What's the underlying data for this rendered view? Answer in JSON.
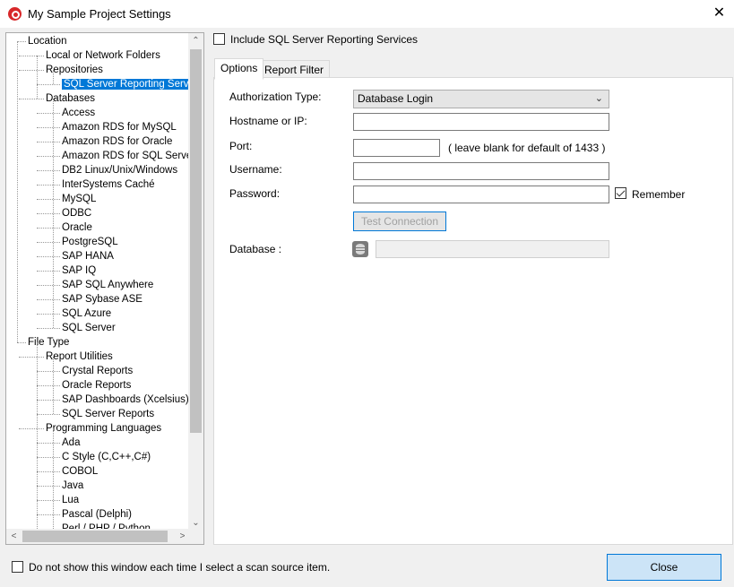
{
  "window": {
    "title": "My Sample Project Settings",
    "close_glyph": "✕"
  },
  "tree": {
    "nodes": [
      {
        "label": "Location",
        "level": 0
      },
      {
        "label": "Local or Network Folders",
        "level": 1
      },
      {
        "label": "Repositories",
        "level": 1
      },
      {
        "label": "SQL Server Reporting Service",
        "level": 2,
        "selected": true
      },
      {
        "label": "Databases",
        "level": 1
      },
      {
        "label": "Access",
        "level": 2
      },
      {
        "label": "Amazon RDS for MySQL",
        "level": 2
      },
      {
        "label": "Amazon RDS for Oracle",
        "level": 2
      },
      {
        "label": "Amazon RDS for SQL Server",
        "level": 2
      },
      {
        "label": "DB2 Linux/Unix/Windows",
        "level": 2
      },
      {
        "label": "InterSystems Caché",
        "level": 2
      },
      {
        "label": "MySQL",
        "level": 2
      },
      {
        "label": "ODBC",
        "level": 2
      },
      {
        "label": "Oracle",
        "level": 2
      },
      {
        "label": "PostgreSQL",
        "level": 2
      },
      {
        "label": "SAP HANA",
        "level": 2
      },
      {
        "label": "SAP IQ",
        "level": 2
      },
      {
        "label": "SAP SQL Anywhere",
        "level": 2
      },
      {
        "label": "SAP Sybase ASE",
        "level": 2
      },
      {
        "label": "SQL Azure",
        "level": 2
      },
      {
        "label": "SQL Server",
        "level": 2
      },
      {
        "label": "File Type",
        "level": 0
      },
      {
        "label": "Report Utilities",
        "level": 1
      },
      {
        "label": "Crystal Reports",
        "level": 2
      },
      {
        "label": "Oracle Reports",
        "level": 2
      },
      {
        "label": "SAP Dashboards (Xcelsius)",
        "level": 2
      },
      {
        "label": "SQL Server Reports",
        "level": 2
      },
      {
        "label": "Programming Languages",
        "level": 1
      },
      {
        "label": "Ada",
        "level": 2
      },
      {
        "label": "C Style (C,C++,C#)",
        "level": 2
      },
      {
        "label": "COBOL",
        "level": 2
      },
      {
        "label": "Java",
        "level": 2
      },
      {
        "label": "Lua",
        "level": 2
      },
      {
        "label": "Pascal (Delphi)",
        "level": 2
      },
      {
        "label": "Perl / PHP / Python",
        "level": 2
      }
    ],
    "scroll_up": "⌃",
    "scroll_down": "⌄",
    "scroll_left": "<",
    "scroll_right": ">"
  },
  "include_ssrs": {
    "label": "Include SQL Server Reporting Services",
    "checked": false
  },
  "tabs": [
    {
      "label": "Options",
      "active": true
    },
    {
      "label": "Report Filter",
      "active": false
    }
  ],
  "form": {
    "auth_type_label": "Authorization Type:",
    "auth_type_value": "Database Login",
    "hostname_label": "Hostname or IP:",
    "hostname_value": "",
    "port_label": "Port:",
    "port_value": "",
    "port_hint": "( leave blank for default of 1433 )",
    "username_label": "Username:",
    "username_value": "",
    "password_label": "Password:",
    "password_value": "",
    "remember_label": "Remember",
    "remember_checked": true,
    "test_button": "Test Connection",
    "database_label": "Database :",
    "database_value": ""
  },
  "footer": {
    "dont_show_label": "Do not show this window each time I select a scan source item.",
    "dont_show_checked": false,
    "close_button": "Close"
  }
}
